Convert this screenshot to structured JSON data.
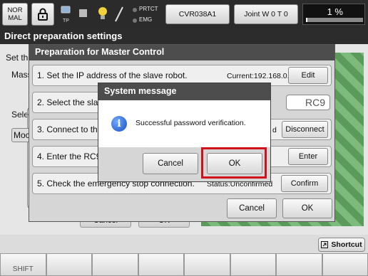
{
  "topbar": {
    "mode_line1": "NOR",
    "mode_line2": "MAL",
    "tp_label": "TP",
    "prtct_label": "PRTCT",
    "emg_label": "EMG",
    "robot_name": "CVR038A1",
    "joint_label": "Joint W 0 T 0",
    "speed_text": "1 %",
    "speed_value": 0.01
  },
  "window": {
    "title": "Direct preparation settings"
  },
  "background": {
    "set_label": "Set the",
    "mass_label": "Mass",
    "select_label": "Selec",
    "mode_label": "Moc",
    "cancel_label": "Cancel",
    "ok_label": "OK"
  },
  "prep_dialog": {
    "title": "Preparation for Master Control",
    "steps": [
      {
        "text": "1. Set the IP address of the slave robot.",
        "info": "Current:192.168.0.1",
        "button": "Edit"
      },
      {
        "text": "2. Select the slav",
        "info": "RC9"
      },
      {
        "text": "3. Connect to the",
        "info": "d",
        "button": "Disconnect"
      },
      {
        "text": "4. Enter the RC9",
        "button": "Enter"
      },
      {
        "text": "5. Check the emergency stop connection.",
        "info": "Status:Unconfirmed",
        "button": "Confirm"
      }
    ],
    "cancel_label": "Cancel",
    "ok_label": "OK"
  },
  "message_dialog": {
    "title": "System message",
    "message": "Successful password verification.",
    "icon": "info-icon",
    "cancel_label": "Cancel",
    "ok_label": "OK"
  },
  "footer": {
    "shortcut_label": "Shortcut",
    "fkeys": [
      "SHIFT",
      "",
      "",
      "",
      "",
      "",
      "",
      ""
    ]
  },
  "colors": {
    "highlight": "#d0101a",
    "title_bar": "#4d4d4d"
  }
}
